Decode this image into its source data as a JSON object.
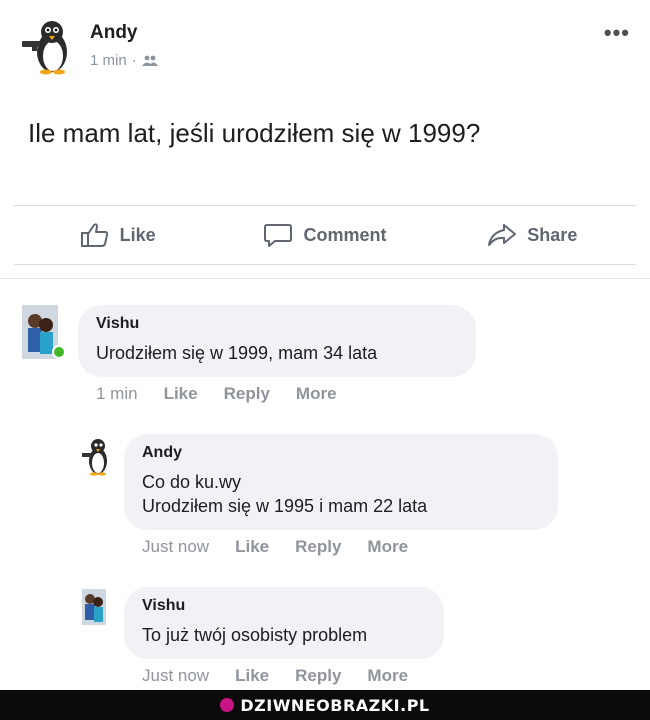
{
  "post": {
    "author": "Andy",
    "time": "1 min",
    "separator": "·",
    "privacy_icon": "friends-icon",
    "text": "Ile mam lat, jeśli urodziłem się w 1999?",
    "more_icon": "more-dots-icon",
    "more_label": "•••"
  },
  "actions": {
    "like": "Like",
    "comment": "Comment",
    "share": "Share"
  },
  "comments": [
    {
      "author": "Vishu",
      "lines": [
        "Urodziłem się w 1999, mam 34 lata"
      ],
      "time": "1 min",
      "like": "Like",
      "reply": "Reply",
      "more": "More"
    },
    {
      "author": "Andy",
      "lines": [
        "Co do ku.wy",
        "Urodziłem się w 1995 i mam 22 lata"
      ],
      "time": "Just now",
      "like": "Like",
      "reply": "Reply",
      "more": "More"
    },
    {
      "author": "Vishu",
      "lines": [
        "To już twój osobisty problem"
      ],
      "time": "Just now",
      "like": "Like",
      "reply": "Reply",
      "more": "More"
    }
  ],
  "footer": {
    "watermark": "DZIWNEOBRAZKI.PL"
  },
  "colors": {
    "online": "#42b72a",
    "bubble": "#f0f2f5",
    "muted": "#90949c"
  }
}
